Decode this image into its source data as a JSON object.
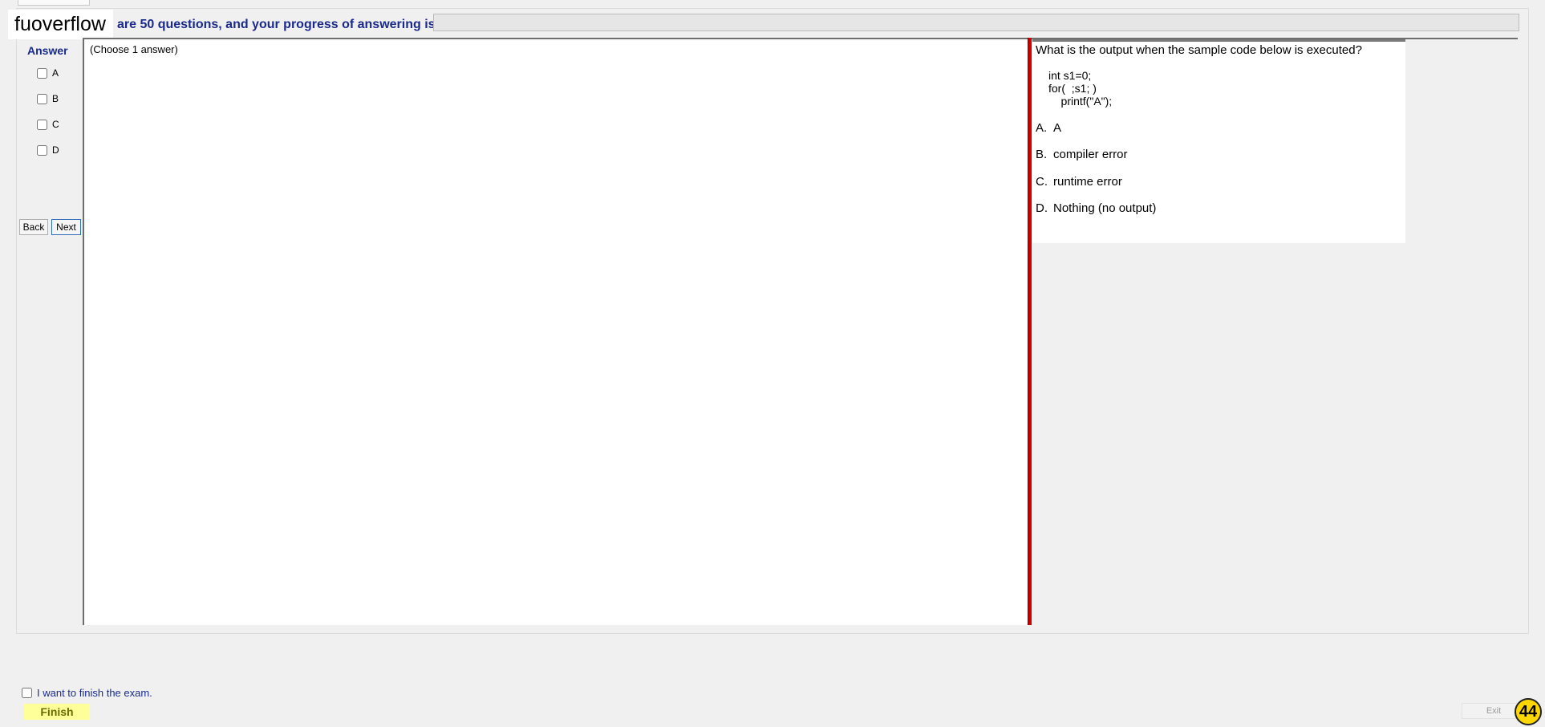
{
  "header": {
    "brand": "fuoverflow",
    "progress_text": "are 50 questions, and your progress of answering is",
    "progress_fraction": 0
  },
  "answer_panel": {
    "title": "Answer",
    "options": [
      "A",
      "B",
      "C",
      "D"
    ],
    "back_label": "Back",
    "next_label": "Next"
  },
  "center": {
    "hint": "(Choose 1 answer)"
  },
  "question": {
    "text": "What is the output when the sample code below is executed?",
    "code": "int s1=0;\nfor(  ;s1; )\n    printf(\"A\");",
    "options": [
      {
        "letter": "A.",
        "text": "A"
      },
      {
        "letter": "B.",
        "text": "compiler error"
      },
      {
        "letter": "C.",
        "text": "runtime error"
      },
      {
        "letter": "D.",
        "text": "Nothing (no output)"
      }
    ]
  },
  "footer": {
    "finish_checkbox_label": "I want to finish the exam.",
    "finish_label": "Finish",
    "exit_label": "Exit",
    "counter": "44"
  }
}
